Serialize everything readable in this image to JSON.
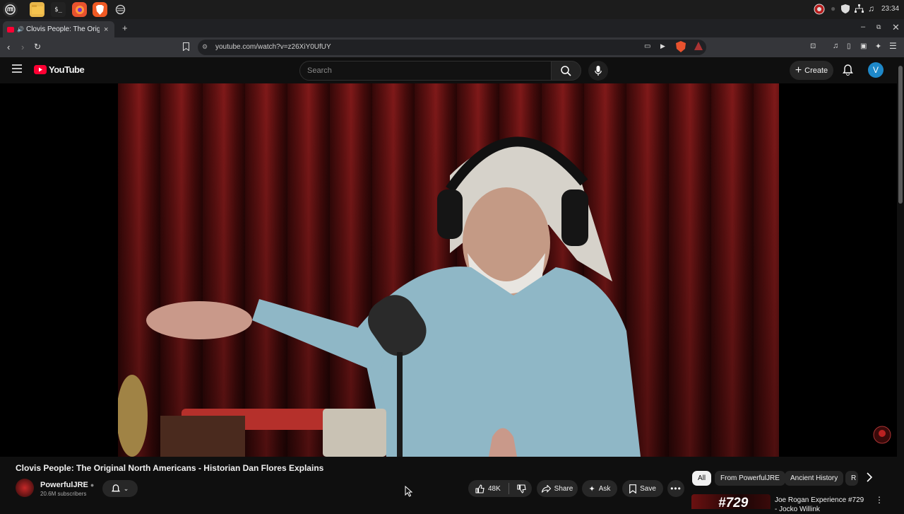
{
  "os_taskbar": {
    "clock": "23:34",
    "apps": [
      "mint-menu-icon",
      "files-icon",
      "terminal-icon",
      "firefox-icon",
      "brave-icon",
      "settings-icon"
    ]
  },
  "browser": {
    "tab": {
      "title": "Clovis People: The Original North Americans - Historian Dan Flores Explains",
      "close": "×"
    },
    "new_tab": "+",
    "url": "youtube.com/watch?v=z26XiY0UfUY"
  },
  "youtube": {
    "logo_text": "YouTube",
    "search": {
      "placeholder": "Search"
    },
    "create_label": "Create",
    "avatar_letter": "V"
  },
  "video": {
    "title": "Clovis People: The Original North Americans - Historian Dan Flores Explains",
    "channel": "PowerfulJRE",
    "subscribers": "20.6M subscribers",
    "likes": "48K",
    "share_label": "Share",
    "ask_label": "Ask",
    "save_label": "Save"
  },
  "chips": [
    {
      "label": "All",
      "active": true
    },
    {
      "label": "From PowerfulJRE",
      "active": false
    },
    {
      "label": "Ancient History",
      "active": false
    },
    {
      "label": "R",
      "active": false
    }
  ],
  "recommendation": {
    "thumb_text": "#729",
    "title": "Joe Rogan Experience #729 - Jocko Willink"
  },
  "colors": {
    "brand_red": "#ff0033",
    "background": "#0f0f0f",
    "avatar_blue": "#1e88c9"
  }
}
